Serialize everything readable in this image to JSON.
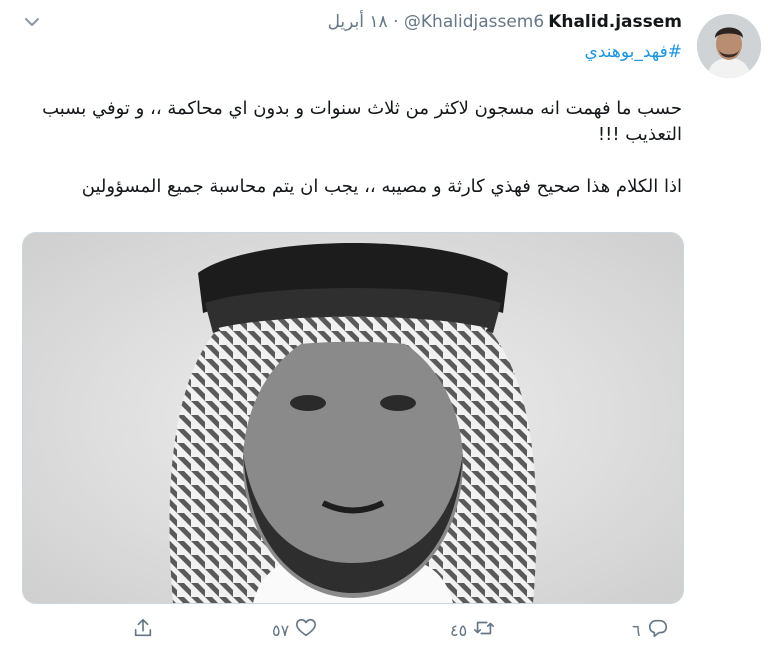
{
  "tweet": {
    "author_name": "Khalid.jassem",
    "author_handle": "@Khalidjassem6",
    "separator": "·",
    "date": "١٨ أبريل",
    "hashtag": "#فهد_بوهندي",
    "text": "حسب ما فهمت انه مسجون لاكثر من ثلاث سنوات و بدون اي محاكمة ،، و توفي بسبب التعذيب !!!\n\nاذا الكلام هذا صحيح فهذي كارثة و مصيبه ،، يجب ان يتم محاسبة جميع المسؤولين",
    "actions": {
      "reply_count": "٦",
      "retweet_count": "٤٥",
      "like_count": "٥٧"
    }
  },
  "icons": {
    "menu": "chevron-down-icon",
    "reply": "reply-icon",
    "retweet": "retweet-icon",
    "like": "heart-icon",
    "share": "share-icon"
  },
  "colors": {
    "link": "#1b95e0",
    "secondary_text": "#657786",
    "border": "#ccd6dd"
  }
}
